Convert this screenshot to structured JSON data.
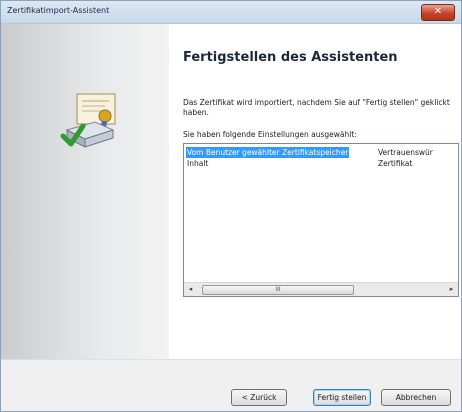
{
  "window": {
    "title": "Zertifikatimport-Assistent",
    "close_label": "✕"
  },
  "page": {
    "heading": "Fertigstellen des Assistenten",
    "description": "Das Zertifikat wird importiert, nachdem Sie auf \"Fertig stellen\" geklickt haben.",
    "settings_label": "Sie haben folgende Einstellungen ausgewählt:",
    "settings": [
      {
        "name": "Vom Benutzer gewählter Zertifikatspeicher",
        "value": "Vertrauenswür"
      },
      {
        "name": "Inhalt",
        "value": "Zertifikat"
      }
    ],
    "scroll_grip": "III"
  },
  "buttons": {
    "back": "< Zurück",
    "finish": "Fertig stellen",
    "cancel": "Abbrechen"
  },
  "icons": {
    "certificate": "certificate-import-icon",
    "scroll_left": "◂",
    "scroll_right": "▸"
  }
}
